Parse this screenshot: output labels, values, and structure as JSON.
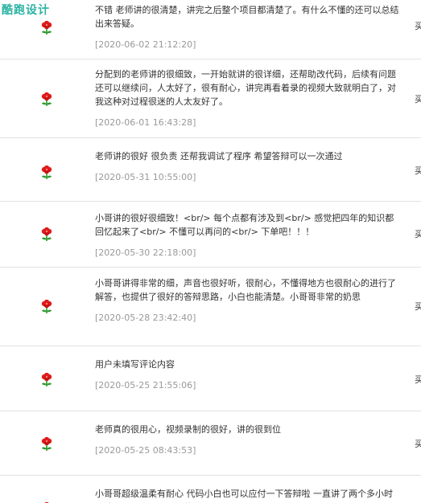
{
  "logo": {
    "text": "酷跑设计"
  },
  "right_mark": "买",
  "icon": "red-flower-icon",
  "colors": {
    "date": "#999999",
    "divider": "#e2e2e2",
    "logo": "#2bb3a3",
    "flower": "#e01b1b",
    "leaf": "#2e9a2e"
  },
  "reviews": [
    {
      "comment": "不错 老师讲的很清楚，讲完之后整个项目都清楚了。有什么不懂的还可以总结出来答疑。",
      "date": "[2020-06-02 21:12:20]"
    },
    {
      "comment": "分配到的老师讲的很细致，一开始就讲的很详细，还帮助改代码，后续有问题还可以继续问，人太好了，很有耐心，讲完再看着录的视频大致就明白了，对我这种对过程很迷的人太友好了。",
      "date": "[2020-06-01 16:43:28]"
    },
    {
      "comment": "老师讲的很好 很负责 还帮我调试了程序 希望答辩可以一次通过",
      "date": "[2020-05-31 10:55:00]"
    },
    {
      "comment": "小哥讲的很好很细致！<br/> 每个点都有涉及到<br/> 感觉把四年的知识都回忆起来了<br/> 不懂可以再问的<br/> 下单吧！！！",
      "date": "[2020-05-30 22:18:00]"
    },
    {
      "comment": "小哥哥讲得非常的细，声音也很好听，很耐心，不懂得地方也很耐心的进行了解答，也提供了很好的答辩思路，小白也能清楚。小哥哥非常的奶思",
      "date": "[2020-05-28 23:42:40]"
    },
    {
      "comment": "用户未填写评论内容",
      "date": "[2020-05-25 21:55:06]"
    },
    {
      "comment": "老师真的很用心，视频录制的很好，讲的很到位",
      "date": "[2020-05-25 08:43:53]"
    },
    {
      "comment": "小哥哥超级温柔有耐心 代码小白也可以应付一下答辩啦 一直讲了两个多小时 后续有问题还可以再问他",
      "date": ""
    }
  ]
}
